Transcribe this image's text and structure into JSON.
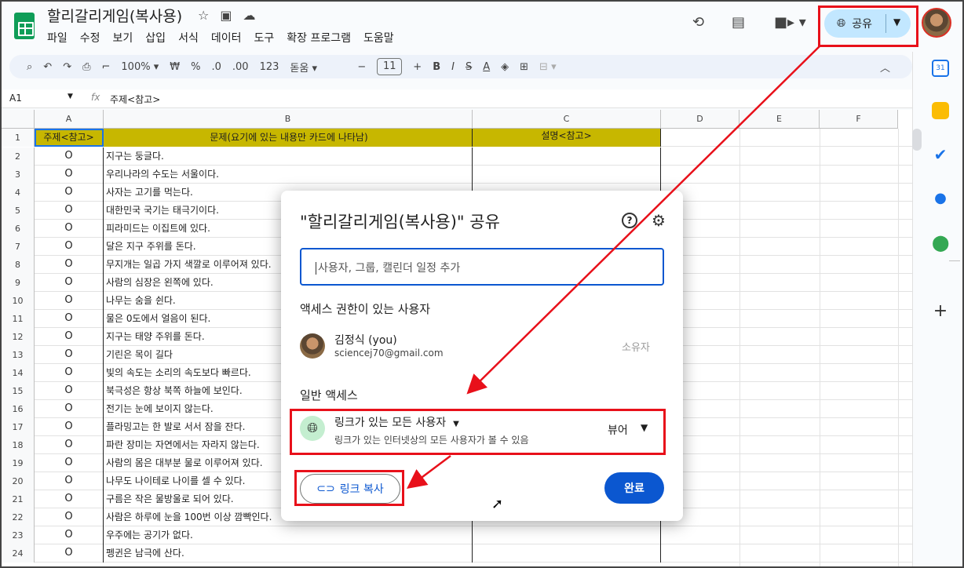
{
  "app": {
    "doc_title": "할리갈리게임(복사용)",
    "menu": [
      "파일",
      "수정",
      "보기",
      "삽입",
      "서식",
      "데이터",
      "도구",
      "확장 프로그램",
      "도움말"
    ],
    "share_label": "공유"
  },
  "toolbar": {
    "zoom": "100%",
    "currency": "₩",
    "percent": "%",
    "dec_minus": ".0",
    "dec_plus": ".00",
    "num_format": "123",
    "font": "돋움",
    "font_size": "11"
  },
  "formula_bar": {
    "cell_ref": "A1",
    "value": "주제<참고>"
  },
  "columns": [
    "A",
    "B",
    "C",
    "D",
    "E",
    "F"
  ],
  "header_row": {
    "num": "1",
    "a": "주제<참고>",
    "b": "문제(요기에 있는 내용만 카드에 나타남)",
    "c": "설명<참고>"
  },
  "rows": [
    {
      "num": "2",
      "a": "O",
      "b": "지구는 둥글다."
    },
    {
      "num": "3",
      "a": "O",
      "b": "우리나라의 수도는 서울이다."
    },
    {
      "num": "4",
      "a": "O",
      "b": "사자는 고기를 먹는다."
    },
    {
      "num": "5",
      "a": "O",
      "b": "대한민국 국기는 태극기이다."
    },
    {
      "num": "6",
      "a": "O",
      "b": "피라미드는 이집트에 있다."
    },
    {
      "num": "7",
      "a": "O",
      "b": "달은 지구 주위를 돈다."
    },
    {
      "num": "8",
      "a": "O",
      "b": "무지개는 일곱 가지 색깔로 이루어져 있다."
    },
    {
      "num": "9",
      "a": "O",
      "b": "사람의 심장은 왼쪽에 있다."
    },
    {
      "num": "10",
      "a": "O",
      "b": "나무는 숨을 쉰다."
    },
    {
      "num": "11",
      "a": "O",
      "b": "물은 0도에서 얼음이 된다."
    },
    {
      "num": "12",
      "a": "O",
      "b": "지구는 태양 주위를 돈다."
    },
    {
      "num": "13",
      "a": "O",
      "b": "기린은 목이 길다"
    },
    {
      "num": "14",
      "a": "O",
      "b": "빛의 속도는 소리의 속도보다 빠르다."
    },
    {
      "num": "15",
      "a": "O",
      "b": "북극성은 항상 북쪽 하늘에 보인다."
    },
    {
      "num": "16",
      "a": "O",
      "b": "전기는 눈에 보이지 않는다."
    },
    {
      "num": "17",
      "a": "O",
      "b": "플라밍고는 한 발로 서서 잠을 잔다."
    },
    {
      "num": "18",
      "a": "O",
      "b": "파란 장미는 자연에서는 자라지 않는다."
    },
    {
      "num": "19",
      "a": "O",
      "b": "사람의 몸은 대부분 물로 이루어져 있다."
    },
    {
      "num": "20",
      "a": "O",
      "b": "나무도 나이테로 나이를 셀 수 있다."
    },
    {
      "num": "21",
      "a": "O",
      "b": "구름은 작은 물방울로 되어 있다."
    },
    {
      "num": "22",
      "a": "O",
      "b": "사람은 하루에 눈을 100번 이상 깜빡인다."
    },
    {
      "num": "23",
      "a": "O",
      "b": "우주에는 공기가 없다."
    },
    {
      "num": "24",
      "a": "O",
      "b": "펭귄은 남극에 산다."
    }
  ],
  "dialog": {
    "title": "\"할리갈리게임(복사용)\" 공유",
    "input_placeholder": "사용자, 그룹, 캘린더 일정 추가",
    "access_section": "액세스 권한이 있는 사용자",
    "user_name": "김정식 (you)",
    "user_email": "sciencej70@gmail.com",
    "owner_label": "소유자",
    "general_section": "일반 액세스",
    "general_who": "링크가 있는 모든 사용자",
    "general_desc": "링크가 있는 인터넷상의 모든 사용자가 볼 수 있음",
    "role": "뷰어",
    "copy_link": "링크 복사",
    "done": "완료"
  },
  "colors": {
    "header_fill": "#c7b700",
    "accent": "#0b57d0",
    "share_pill": "#c2e7ff",
    "annotation": "#e8101a"
  }
}
